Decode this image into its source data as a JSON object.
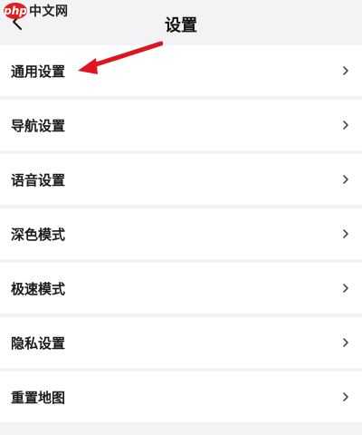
{
  "watermark": {
    "badge": "php",
    "text": "中文网"
  },
  "header": {
    "title": "设置",
    "back_icon": "chevron-left-icon"
  },
  "settings": {
    "items": [
      {
        "label": "通用设置"
      },
      {
        "label": "导航设置"
      },
      {
        "label": "语音设置"
      },
      {
        "label": "深色模式"
      },
      {
        "label": "极速模式"
      },
      {
        "label": "隐私设置"
      },
      {
        "label": "重置地图"
      }
    ],
    "chevron_icon": "chevron-right-icon"
  },
  "annotation": {
    "icon": "red-arrow-icon",
    "color": "#e0141e"
  },
  "colors": {
    "background": "#f3f3f5",
    "row_background": "#ffffff",
    "text": "#1a1a1a"
  }
}
